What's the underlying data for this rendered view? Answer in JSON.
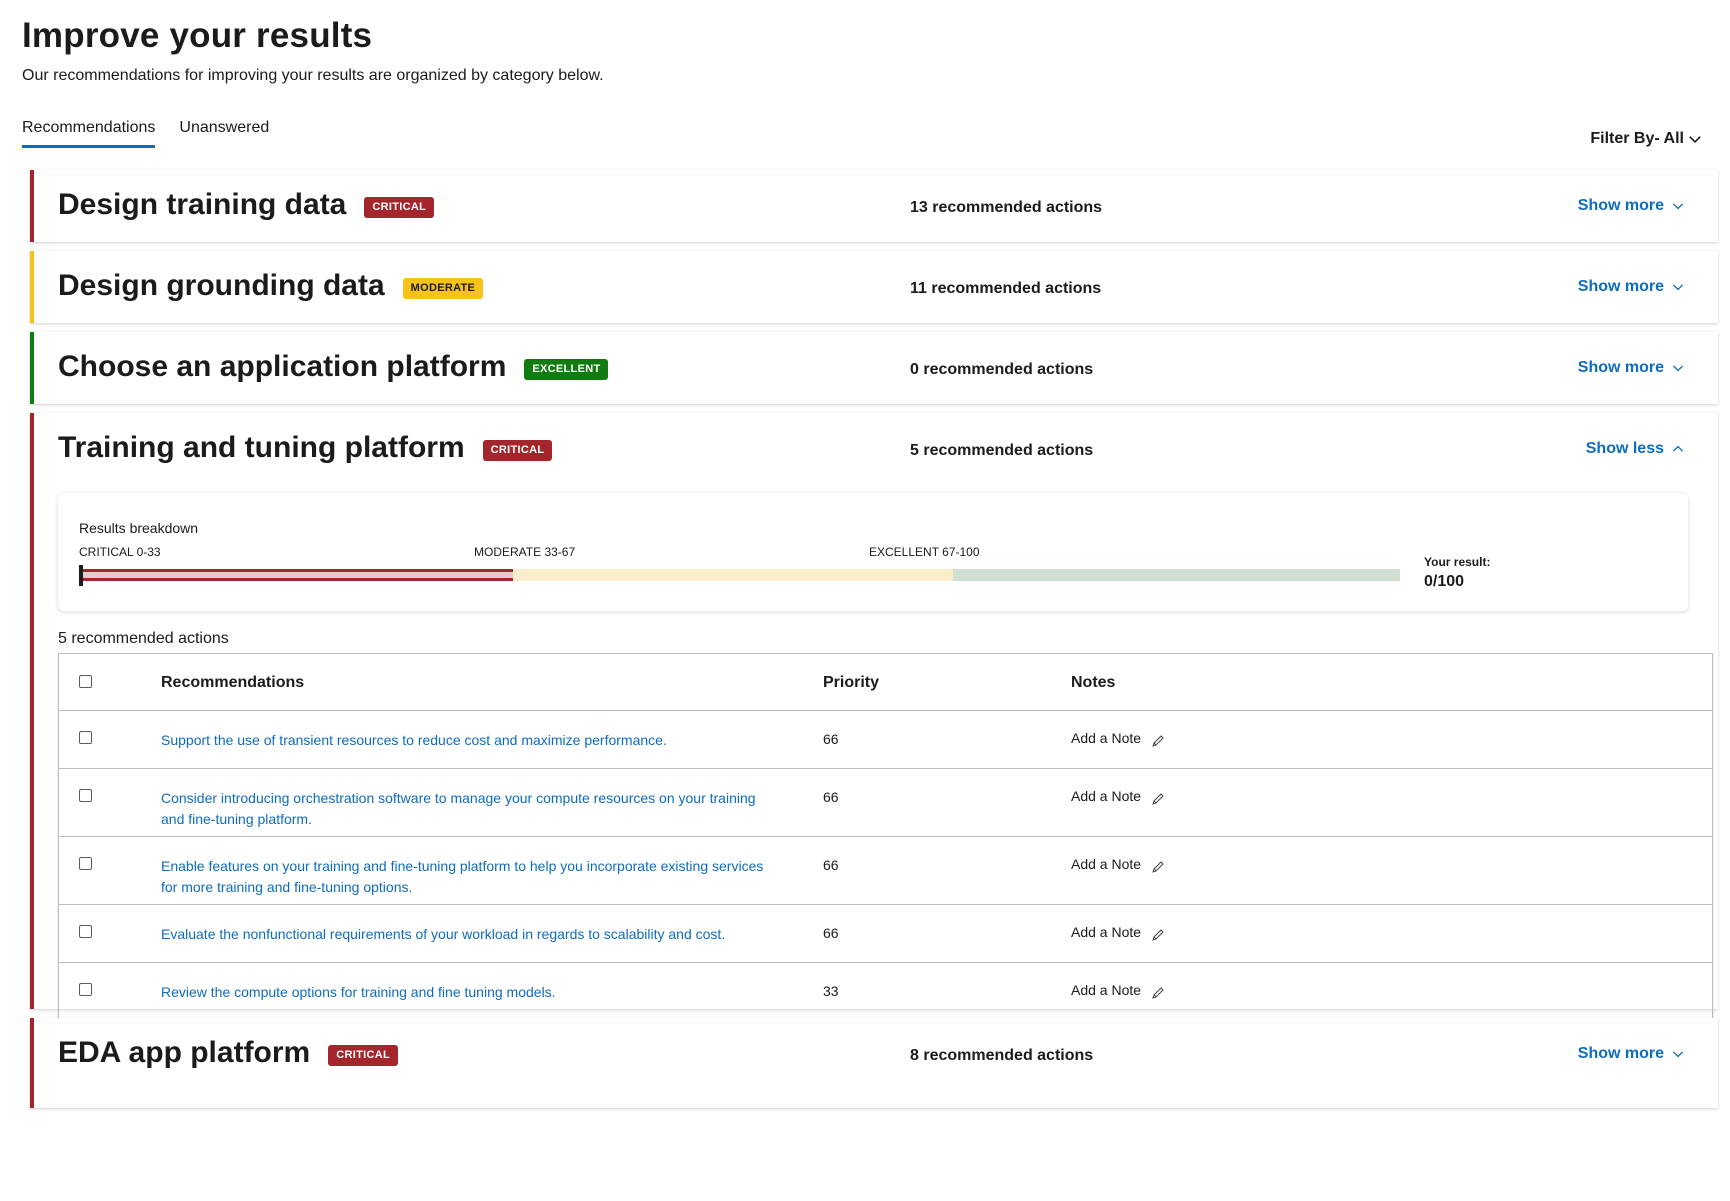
{
  "page": {
    "title": "Improve your results",
    "subtitle": "Our recommendations for improving your results are organized by category below."
  },
  "tabs": [
    {
      "label": "Recommendations",
      "active": true
    },
    {
      "label": "Unanswered",
      "active": false
    }
  ],
  "filter": {
    "label": "Filter By- All"
  },
  "categories": [
    {
      "title": "Design training data",
      "badge": "CRITICAL",
      "severity": "critical",
      "count_label": "13 recommended actions",
      "toggle_label": "Show more"
    },
    {
      "title": "Design grounding data",
      "badge": "MODERATE",
      "severity": "moderate",
      "count_label": "11 recommended actions",
      "toggle_label": "Show more"
    },
    {
      "title": "Choose an application platform",
      "badge": "EXCELLENT",
      "severity": "excellent",
      "count_label": "0 recommended actions",
      "toggle_label": "Show more"
    },
    {
      "title": "Training and tuning platform",
      "badge": "CRITICAL",
      "severity": "critical",
      "count_label": "5 recommended actions",
      "toggle_label": "Show less",
      "expanded": true
    },
    {
      "title": "EDA app platform",
      "badge": "CRITICAL",
      "severity": "critical",
      "count_label": "8 recommended actions",
      "toggle_label": "Show more"
    }
  ],
  "breakdown": {
    "title": "Results breakdown",
    "segments": [
      {
        "label": "CRITICAL 0-33",
        "color": "#a4262c"
      },
      {
        "label": "MODERATE 33-67",
        "color": "#f7c21a"
      },
      {
        "label": "EXCELLENT 67-100",
        "color": "#107c10"
      }
    ],
    "result_label": "Your result:",
    "result_value": "0/100",
    "result_score": 0
  },
  "recommendations": {
    "count_label": "5 recommended actions",
    "columns": [
      "Recommendations",
      "Priority",
      "Notes"
    ],
    "rows": [
      {
        "text": "Support the use of transient resources to reduce cost and maximize performance.",
        "priority": "66",
        "note": "Add a Note"
      },
      {
        "text": "Consider introducing orchestration software to manage your compute resources on your training and fine-tuning platform.",
        "priority": "66",
        "note": "Add a Note"
      },
      {
        "text": "Enable features on your training and fine-tuning platform to help you incorporate existing services for more training and fine-tuning options.",
        "priority": "66",
        "note": "Add a Note"
      },
      {
        "text": "Evaluate the nonfunctional requirements of your workload in regards to scalability and cost.",
        "priority": "66",
        "note": "Add a Note"
      },
      {
        "text": "Review the compute options for training and fine tuning models.",
        "priority": "33",
        "note": "Add a Note"
      }
    ]
  },
  "colors": {
    "accent": "#0f6cbd",
    "critical": "#a4262c",
    "moderate": "#f7c21a",
    "excellent": "#107c10"
  },
  "icons": {
    "chevron_down": "chevron-down-icon",
    "chevron_up": "chevron-up-icon",
    "pencil": "pencil-icon"
  }
}
